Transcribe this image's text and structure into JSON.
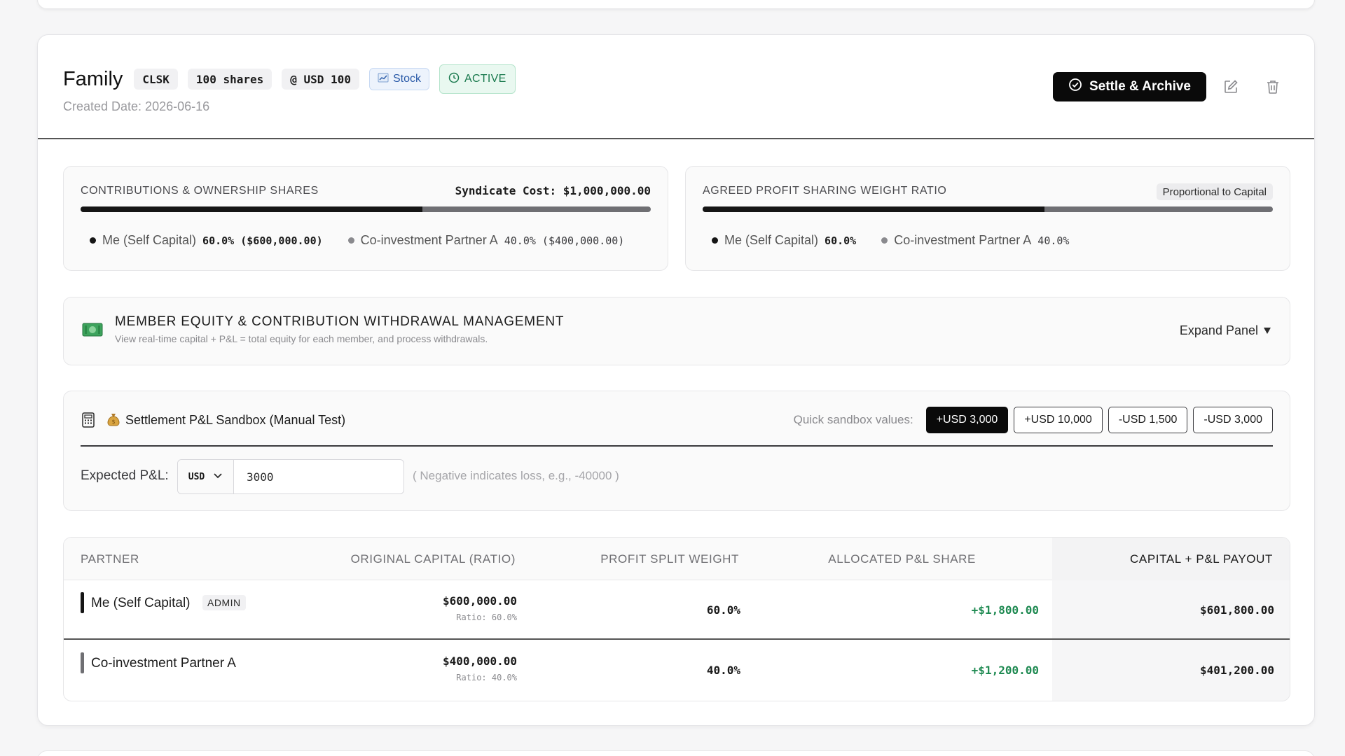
{
  "group": {
    "title": "Family",
    "ticker": "CLSK",
    "shares": "100 shares",
    "price": "@ USD 100",
    "type_label": "Stock",
    "type_icon": "chart-icon",
    "status": "ACTIVE",
    "created": "Created Date: 2026-06-16"
  },
  "actions": {
    "settle_label": "Settle & Archive",
    "edit_icon": "edit-icon",
    "delete_icon": "trash-icon"
  },
  "contributions": {
    "label": "CONTRIBUTIONS & OWNERSHIP SHARES",
    "cost_label": "Syndicate Cost: $1,000,000.00",
    "members": [
      {
        "name": "Me (Self Capital)",
        "value": "60.0% ($600,000.00)",
        "share": 0.6,
        "color": "#151515"
      },
      {
        "name": "Co-investment Partner A",
        "value": "40.0% ($400,000.00)",
        "share": 0.4,
        "color": "#6f6f73"
      }
    ]
  },
  "profit_weights": {
    "label": "AGREED PROFIT SHARING WEIGHT RATIO",
    "mode": "Proportional to Capital",
    "members": [
      {
        "name": "Me (Self Capital)",
        "value": "60.0%",
        "share": 0.6,
        "color": "#151515"
      },
      {
        "name": "Co-investment Partner A",
        "value": "40.0%",
        "share": 0.4,
        "color": "#6f6f73"
      }
    ]
  },
  "equity_panel": {
    "icon": "money-icon",
    "title": "MEMBER EQUITY & CONTRIBUTION WITHDRAWAL MANAGEMENT",
    "subtitle": "View real-time capital + P&L = total equity for each member, and process withdrawals.",
    "expand_label": "Expand Panel"
  },
  "sandbox": {
    "calc_icon": "calculator-icon",
    "title_icon": "money-bag-icon",
    "title": "Settlement P&L Sandbox (Manual Test)",
    "quick_label": "Quick sandbox values:",
    "quick_values": [
      "+USD 3,000",
      "+USD 10,000",
      "-USD 1,500",
      "-USD 3,000"
    ],
    "active_index": 0,
    "expected_label": "Expected P&L:",
    "currency": "USD",
    "amount": "3000",
    "hint": "( Negative indicates loss, e.g., -40000 )"
  },
  "table": {
    "headers": [
      "PARTNER",
      "ORIGINAL CAPITAL (RATIO)",
      "PROFIT SPLIT WEIGHT",
      "ALLOCATED P&L SHARE",
      "CAPITAL + P&L PAYOUT"
    ],
    "rows": [
      {
        "partner": "Me (Self Capital)",
        "badge": "ADMIN",
        "capital": "$600,000.00",
        "ratio": "Ratio: 60.0%",
        "weight": "60.0%",
        "pnl": "+$1,800.00",
        "payout": "$601,800.00",
        "accent": "#151515"
      },
      {
        "partner": "Co-investment Partner A",
        "badge": "",
        "capital": "$400,000.00",
        "ratio": "Ratio: 40.0%",
        "weight": "40.0%",
        "pnl": "+$1,200.00",
        "payout": "$401,200.00",
        "accent": "#6f6f73"
      }
    ]
  },
  "colors": {
    "positive": "#1f8a52",
    "accent_dark": "#0a0a0a"
  }
}
